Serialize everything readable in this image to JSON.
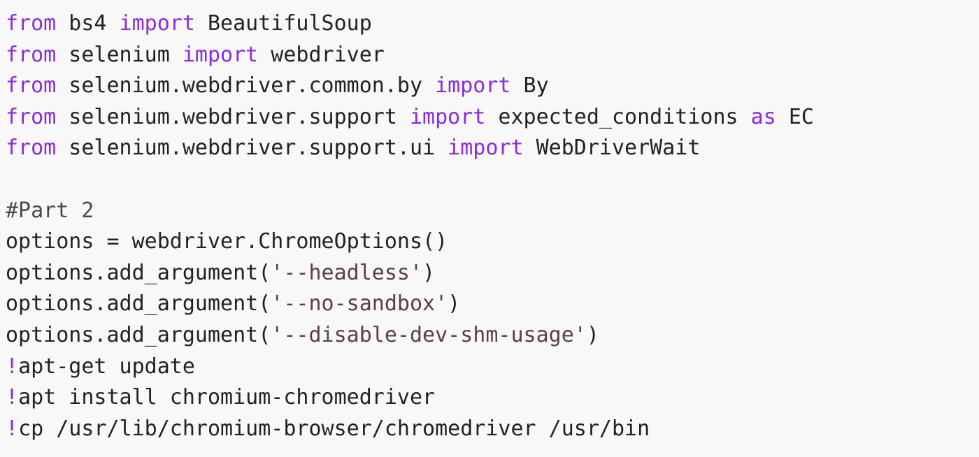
{
  "code": {
    "lines": [
      [
        {
          "t": "kw",
          "v": "from"
        },
        {
          "t": "plain",
          "v": " bs4 "
        },
        {
          "t": "kw",
          "v": "import"
        },
        {
          "t": "plain",
          "v": " BeautifulSoup"
        }
      ],
      [
        {
          "t": "kw",
          "v": "from"
        },
        {
          "t": "plain",
          "v": " selenium "
        },
        {
          "t": "kw",
          "v": "import"
        },
        {
          "t": "plain",
          "v": " webdriver"
        }
      ],
      [
        {
          "t": "kw",
          "v": "from"
        },
        {
          "t": "plain",
          "v": " selenium.webdriver.common.by "
        },
        {
          "t": "kw",
          "v": "import"
        },
        {
          "t": "plain",
          "v": " By"
        }
      ],
      [
        {
          "t": "kw",
          "v": "from"
        },
        {
          "t": "plain",
          "v": " selenium.webdriver.support "
        },
        {
          "t": "kw",
          "v": "import"
        },
        {
          "t": "plain",
          "v": " expected_conditions "
        },
        {
          "t": "kw",
          "v": "as"
        },
        {
          "t": "plain",
          "v": " EC"
        }
      ],
      [
        {
          "t": "kw",
          "v": "from"
        },
        {
          "t": "plain",
          "v": " selenium.webdriver.support.ui "
        },
        {
          "t": "kw",
          "v": "import"
        },
        {
          "t": "plain",
          "v": " WebDriverWait"
        }
      ],
      [],
      [
        {
          "t": "cmt",
          "v": "#Part 2"
        }
      ],
      [
        {
          "t": "plain",
          "v": "options = webdriver.ChromeOptions()"
        }
      ],
      [
        {
          "t": "plain",
          "v": "options.add_argument("
        },
        {
          "t": "str",
          "v": "'--headless'"
        },
        {
          "t": "plain",
          "v": ")"
        }
      ],
      [
        {
          "t": "plain",
          "v": "options.add_argument("
        },
        {
          "t": "str",
          "v": "'--no-sandbox'"
        },
        {
          "t": "plain",
          "v": ")"
        }
      ],
      [
        {
          "t": "plain",
          "v": "options.add_argument("
        },
        {
          "t": "str",
          "v": "'--disable-dev-shm-usage'"
        },
        {
          "t": "plain",
          "v": ")"
        }
      ],
      [
        {
          "t": "bang",
          "v": "!"
        },
        {
          "t": "plain",
          "v": "apt-get update"
        }
      ],
      [
        {
          "t": "bang",
          "v": "!"
        },
        {
          "t": "plain",
          "v": "apt install chromium-chromedriver"
        }
      ],
      [
        {
          "t": "bang",
          "v": "!"
        },
        {
          "t": "plain",
          "v": "cp /usr/lib/chromium-browser/chromedriver /usr/bin"
        }
      ]
    ]
  },
  "colors": {
    "background": "#f8f8f8",
    "keyword": "#8a2be2",
    "string": "#5a4040",
    "text": "#222222"
  }
}
